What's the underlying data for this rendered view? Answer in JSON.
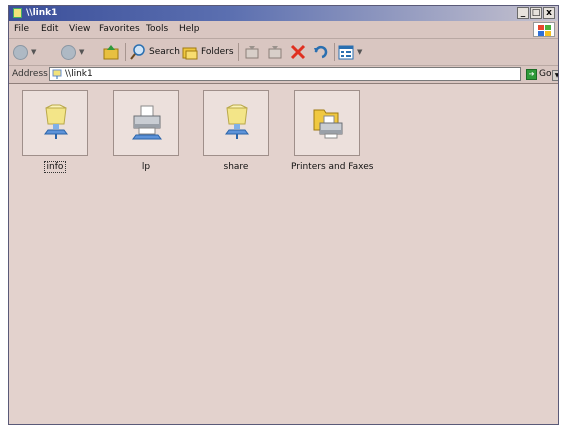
{
  "window": {
    "title": "\\\\link1",
    "controls": {
      "minimize": "_",
      "maximize": "□",
      "close": "x"
    }
  },
  "menu": {
    "items": [
      "File",
      "Edit",
      "View",
      "Favorites",
      "Tools",
      "Help"
    ]
  },
  "toolbar": {
    "search_label": "Search",
    "folders_label": "Folders"
  },
  "address": {
    "label": "Address",
    "value": "\\\\link1",
    "go_label": "Go"
  },
  "files": [
    {
      "name": "info",
      "icon": "network-share-icon",
      "selected": true
    },
    {
      "name": "lp",
      "icon": "printer-icon",
      "selected": false
    },
    {
      "name": "share",
      "icon": "network-share-icon",
      "selected": false
    },
    {
      "name": "Printers and Faxes",
      "icon": "printers-faxes-icon",
      "selected": false
    }
  ],
  "colors": {
    "titlebar_start": "#3b4f9a",
    "window_bg": "#dcc8c3",
    "content_bg": "#e3d2cd",
    "go_green": "#2f9a3a",
    "delete_red": "#e03020"
  }
}
